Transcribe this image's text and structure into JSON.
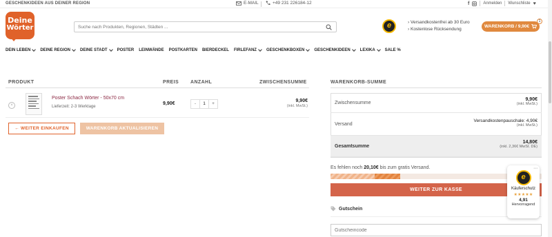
{
  "topbar": {
    "tagline": "GESCHENKIDEEN AUS DEINER REGION",
    "email_label": "E-MAIL",
    "phone": "+49 231 226184-12",
    "login": "Anmelden",
    "wishlist": "Wunschliste"
  },
  "header": {
    "logo_line1": "Deine",
    "logo_line2": "Wörter",
    "search_placeholder": "Suche nach Produkten, Regionen, Städten ...",
    "usp1": "Versandkostenfrei ab 30 Euro",
    "usp2": "Kostenlose Rücksendung",
    "cart_label": "WARENKORB / 9,90€",
    "cart_count": "1"
  },
  "nav": [
    {
      "label": "DEIN LEBEN",
      "dropdown": true
    },
    {
      "label": "DEINE REGION",
      "dropdown": true
    },
    {
      "label": "DEINE STADT",
      "dropdown": true
    },
    {
      "label": "POSTER",
      "dropdown": false
    },
    {
      "label": "LEINWÄNDE",
      "dropdown": false
    },
    {
      "label": "POSTKARTEN",
      "dropdown": false
    },
    {
      "label": "BIERDECKEL",
      "dropdown": false
    },
    {
      "label": "FIRLEFANZ",
      "dropdown": true
    },
    {
      "label": "GESCHENKBOXEN",
      "dropdown": true
    },
    {
      "label": "GESCHENKIDEEN",
      "dropdown": true
    },
    {
      "label": "LEXIKA",
      "dropdown": true
    },
    {
      "label": "SALE %",
      "dropdown": false
    }
  ],
  "cart": {
    "col_product": "PRODUKT",
    "col_price": "PREIS",
    "col_qty": "ANZAHL",
    "col_subtotal": "ZWISCHENSUMME",
    "item": {
      "name": "Poster Schach Wörter - 50x70 cm",
      "delivery": "Lieferzeit: 2-3 Werktage",
      "price": "9,90€",
      "qty": "1",
      "minus": "-",
      "plus": "+",
      "subtotal": "9,90€",
      "tax_note": "(inkl. MwSt.)"
    },
    "continue_btn": "← WEITER EINKAUFEN",
    "update_btn": "WARENKORB AKTUALISIEREN"
  },
  "summary": {
    "title": "WARENKORB-SUMME",
    "subtotal_label": "Zwischensumme",
    "subtotal_value": "9,90€",
    "subtotal_note": "(inkl. MwSt.)",
    "shipping_label": "Versand",
    "shipping_value": "Versandkostenpauschale: 4,90€",
    "shipping_note": "(inkl. MwSt.)",
    "total_label": "Gesamtsumme",
    "total_value": "14,80€",
    "total_note": "(inkl. 2,36€ MwSt. DE)",
    "free_ship_prefix": "Es fehlen noch",
    "free_ship_amount": "20,10€",
    "free_ship_suffix": "bis zum gratis Versand.",
    "progress_fraction": 0.33,
    "checkout_btn": "WEITER ZUR KASSE",
    "coupon_title": "Gutschein",
    "coupon_placeholder": "Gutscheincode"
  },
  "trust_widget": {
    "label": "Käuferschutz",
    "stars": "★★★★★",
    "score": "4,91",
    "rating_text": "Hervorragend"
  },
  "colors": {
    "brand_orange": "#e0622a",
    "cart_button": "#e0893f",
    "checkout": "#d4644a",
    "product_link": "#8b2742"
  }
}
